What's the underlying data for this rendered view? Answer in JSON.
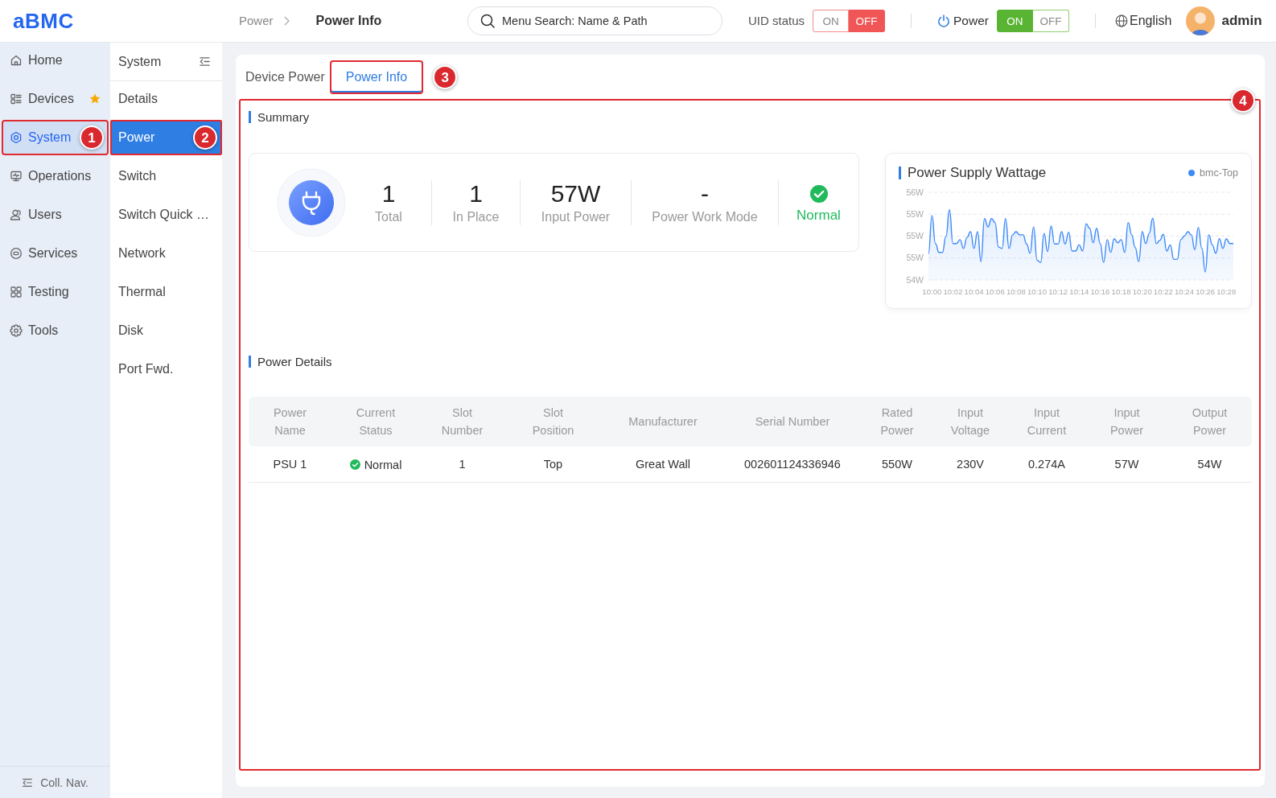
{
  "header": {
    "logo": "aBMC",
    "breadcrumb": [
      "Power",
      "Power Info"
    ],
    "search": {
      "placeholder": "Menu Search: Name & Path"
    },
    "uid_status": {
      "label": "UID status",
      "options": [
        {
          "label": "ON",
          "selected": false
        },
        {
          "label": "OFF",
          "selected": true
        }
      ]
    },
    "power": {
      "label": "Power",
      "options": [
        {
          "label": "ON",
          "selected": true
        },
        {
          "label": "OFF",
          "selected": false
        }
      ]
    },
    "language": "English",
    "user": "admin"
  },
  "nav": {
    "items": [
      {
        "label": "Home",
        "selected": false,
        "favorite": false
      },
      {
        "label": "Devices",
        "selected": false,
        "favorite": true
      },
      {
        "label": "System",
        "selected": true,
        "favorite": false,
        "callout": "1"
      },
      {
        "label": "Operations",
        "selected": false,
        "favorite": false
      },
      {
        "label": "Users",
        "selected": false,
        "favorite": false
      },
      {
        "label": "Services",
        "selected": false,
        "favorite": false
      },
      {
        "label": "Testing",
        "selected": false,
        "favorite": false
      },
      {
        "label": "Tools",
        "selected": false,
        "favorite": false
      }
    ],
    "collapse": "Coll. Nav."
  },
  "subnav": {
    "title": "System",
    "items": [
      {
        "label": "Details",
        "selected": false
      },
      {
        "label": "Power",
        "selected": true,
        "callout": "2"
      },
      {
        "label": "Switch",
        "selected": false
      },
      {
        "label": "Switch Quick …",
        "selected": false
      },
      {
        "label": "Network",
        "selected": false
      },
      {
        "label": "Thermal",
        "selected": false
      },
      {
        "label": "Disk",
        "selected": false
      },
      {
        "label": "Port Fwd.",
        "selected": false
      }
    ]
  },
  "tabs": [
    {
      "label": "Device Power",
      "selected": false
    },
    {
      "label": "Power Info",
      "selected": true,
      "callout": "3"
    }
  ],
  "panel": {
    "callout": "4",
    "summary": {
      "title": "Summary",
      "stats": [
        {
          "value": "1",
          "label": "Total"
        },
        {
          "value": "1",
          "label": "In Place"
        },
        {
          "value": "57W",
          "label": "Input Power"
        },
        {
          "value": "-",
          "label": "Power Work Mode"
        }
      ],
      "status": {
        "label": "Normal",
        "ok": true
      }
    },
    "chart": {
      "chart_data": {
        "type": "area",
        "title": "Power Supply Wattage",
        "grid": true,
        "categories": [
          null,
          "10:00",
          null,
          null,
          null,
          null,
          null,
          "10:02",
          null,
          null,
          null,
          null,
          null,
          "10:04",
          null,
          null,
          null,
          null,
          null,
          "10:06",
          null,
          null,
          null,
          null,
          null,
          "10:08",
          null,
          null,
          null,
          null,
          null,
          "10:10",
          null,
          null,
          null,
          null,
          null,
          "10:12",
          null,
          null,
          null,
          null,
          null,
          "10:14",
          null,
          null,
          null,
          null,
          null,
          "10:16",
          null,
          null,
          null,
          null,
          null,
          "10:18",
          null,
          null,
          null,
          null,
          null,
          "10:20",
          null,
          null,
          null,
          null,
          null,
          "10:22",
          null,
          null,
          null,
          null,
          null,
          "10:24",
          null,
          null,
          null,
          null,
          null,
          "10:26",
          null,
          null,
          null,
          null,
          null,
          "10:28",
          null,
          null
        ],
        "series": [
          {
            "name": "bmc-Top",
            "color": "#3d8af7",
            "values": [
              54.6,
              55.47,
              54.83,
              54.63,
              54.63,
              55.0,
              55.6,
              54.83,
              54.83,
              54.92,
              54.72,
              54.97,
              55.1,
              54.72,
              55.1,
              54.42,
              55.4,
              55.21,
              55.4,
              55.31,
              54.75,
              54.72,
              55.4,
              54.72,
              55.03,
              55.1,
              55.03,
              55.03,
              54.82,
              54.61,
              55.21,
              54.45,
              54.4,
              55.06,
              54.65,
              55.23,
              54.82,
              54.82,
              55.1,
              54.82,
              55.09,
              54.66,
              54.66,
              54.8,
              54.66,
              55.28,
              55.18,
              54.85,
              55.18,
              54.83,
              54.4,
              54.92,
              54.63,
              54.94,
              54.85,
              54.92,
              54.63,
              55.31,
              55.03,
              54.74,
              54.42,
              55.1,
              54.83,
              55.06,
              55.41,
              54.83,
              54.9,
              55.04,
              54.66,
              54.8,
              54.47,
              54.47,
              54.92,
              55.0,
              55.1,
              55.03,
              54.69,
              55.2,
              54.72,
              54.18,
              55.03,
              54.8,
              54.61,
              54.94,
              54.72,
              54.94,
              54.83,
              54.83
            ]
          }
        ],
        "ylim": [
          54,
          56
        ],
        "yticks": [
          {
            "value": 54,
            "label": "54W"
          },
          {
            "value": 54.5,
            "label": "55W"
          },
          {
            "value": 55,
            "label": "55W"
          },
          {
            "value": 55.5,
            "label": "55W"
          },
          {
            "value": 56,
            "label": "56W"
          }
        ]
      }
    },
    "details": {
      "title": "Power Details",
      "table": {
        "columns": [
          "Power Name",
          "Current Status",
          "Slot Number",
          "Slot Position",
          "Manufacturer",
          "Serial Number",
          "Rated Power",
          "Input Voltage",
          "Input Current",
          "Input Power",
          "Output Power"
        ],
        "rows": [
          {
            "cells": [
              {
                "text": "PSU 1"
              },
              {
                "text": "Normal",
                "ok": true
              },
              {
                "text": "1"
              },
              {
                "text": "Top"
              },
              {
                "text": "Great Wall"
              },
              {
                "text": "002601124336946"
              },
              {
                "text": "550W"
              },
              {
                "text": "230V"
              },
              {
                "text": "0.274A"
              },
              {
                "text": "57W"
              },
              {
                "text": "54W"
              }
            ]
          }
        ]
      }
    }
  }
}
